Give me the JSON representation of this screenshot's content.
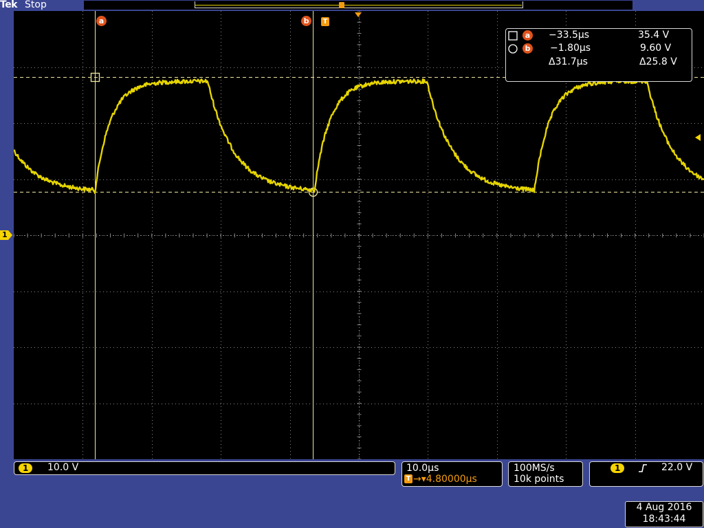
{
  "header": {
    "brand": "Tek",
    "state": "Stop"
  },
  "colors": {
    "trace": "#e6d500",
    "cursor": "#f0e8a0",
    "grid": "#8a8a8a",
    "accent": "#f39c12",
    "background": "#3b4693"
  },
  "cursors": {
    "a_label": "a",
    "b_label": "b",
    "trigger_label": "T",
    "readout": {
      "a_time": "−33.5µs",
      "a_volt": "35.4 V",
      "b_time": "−1.80µs",
      "b_volt": "9.60 V",
      "delta_time": "Δ31.7µs",
      "delta_volt": "Δ25.8 V"
    }
  },
  "channel": {
    "marker": "1",
    "scale": "10.0 V"
  },
  "horizontal": {
    "scale": "10.0µs",
    "trigger_pos": "→▾4.80000µs"
  },
  "acquisition": {
    "rate": "100MS/s",
    "points": "10k points"
  },
  "trigger": {
    "source": "1",
    "slope_icon": "rising-edge-icon",
    "level": "22.0 V"
  },
  "datetime": {
    "date": "4 Aug 2016",
    "time": "18:43:44"
  }
}
